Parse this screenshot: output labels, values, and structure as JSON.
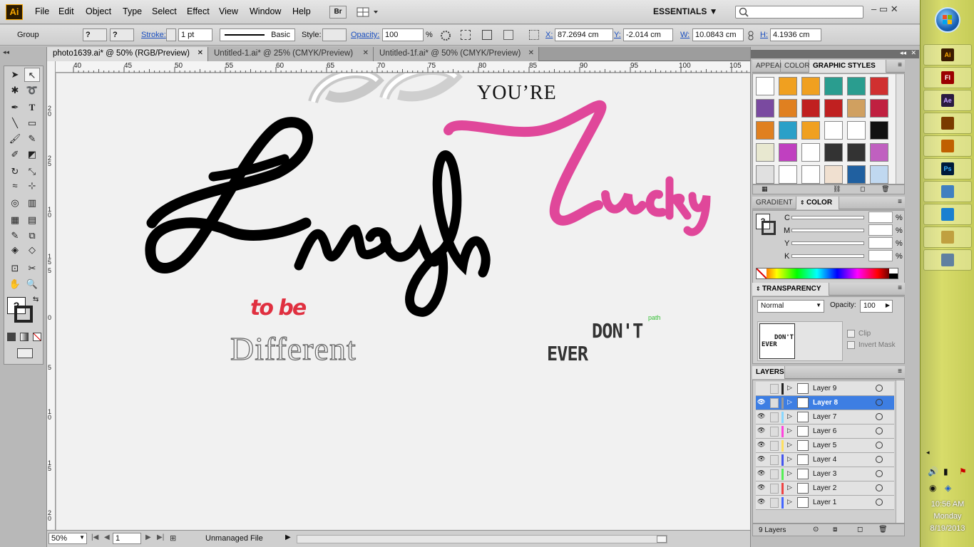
{
  "app": {
    "logo": "Ai"
  },
  "menu": [
    "File",
    "Edit",
    "Object",
    "Type",
    "Select",
    "Effect",
    "View",
    "Window",
    "Help"
  ],
  "menubar": {
    "bridge_label": "Br",
    "workspace": "ESSENTIALS ▼",
    "search_placeholder": "",
    "window_buttons": "–  ▭  ✕"
  },
  "control": {
    "selection": "Group",
    "fill_value": "?",
    "stroke_value": "?",
    "stroke_label": "Stroke:",
    "stroke_weight": "1 pt",
    "brush": "Basic",
    "style_label": "Style:",
    "opacity_label": "Opacity:",
    "opacity_value": "100",
    "opacity_unit": "%",
    "x_label": "X:",
    "x_value": "87.2694 cm",
    "y_label": "Y:",
    "y_value": "-2.014 cm",
    "w_label": "W:",
    "w_value": "10.0843 cm",
    "h_label": "H:",
    "h_value": "4.1936 cm"
  },
  "tabs": [
    {
      "label": "photo1639.ai* @ 50% (RGB/Preview)",
      "close": "✕"
    },
    {
      "label": "Untitled-1.ai* @ 25% (CMYK/Preview)",
      "close": "✕"
    },
    {
      "label": "Untitled-1f.ai* @ 50% (CMYK/Preview)",
      "close": "✕"
    }
  ],
  "ruler": {
    "h_labels": [
      "40",
      "45",
      "50",
      "55",
      "60",
      "65",
      "70",
      "75",
      "80",
      "85",
      "90",
      "95",
      "100",
      "105"
    ],
    "v_labels": [
      "2 0",
      "2 5",
      "1 0",
      "1 5",
      "5",
      "0",
      "5",
      "1 0",
      "1 5",
      "2 0"
    ]
  },
  "artwork": {
    "youre": "YOU’RE",
    "enough": "Enough",
    "lucky": "Lucky",
    "to_be": "to be",
    "different": "Different",
    "dont": "DON'T",
    "ever": "EVER",
    "path_label": "path",
    "pink_color": "#e0479a",
    "red_color": "#e03040"
  },
  "status": {
    "zoom": "50%",
    "page": "1",
    "file_status": "Unmanaged File"
  },
  "panels": {
    "top_tabs": [
      "APPEAI",
      "COLOR",
      "GRAPHIC STYLES"
    ],
    "gradient_tab": "GRADIENT",
    "color_tab": "COLOR",
    "cmyk": [
      {
        "label": "C",
        "unit": "%"
      },
      {
        "label": "M",
        "unit": "%"
      },
      {
        "label": "Y",
        "unit": "%"
      },
      {
        "label": "K",
        "unit": "%"
      }
    ],
    "transparency": {
      "title": "TRANSPARENCY",
      "mode": "Normal",
      "opacity_label": "Opacity:",
      "opacity_value": "100",
      "thumb_line1": "DON'T",
      "thumb_line2": "EVER",
      "clip": "Clip",
      "invert": "Invert Mask"
    },
    "layers": {
      "title": "LAYERS",
      "items": [
        {
          "name": "Layer 9",
          "color": "#222222"
        },
        {
          "name": "Layer 8",
          "color": "#999999"
        },
        {
          "name": "Layer 7",
          "color": "#88d8ff"
        },
        {
          "name": "Layer 6",
          "color": "#ff44dd"
        },
        {
          "name": "Layer 5",
          "color": "#ffe060"
        },
        {
          "name": "Layer 4",
          "color": "#4455ee"
        },
        {
          "name": "Layer 3",
          "color": "#55ee55"
        },
        {
          "name": "Layer 2",
          "color": "#ee4444"
        },
        {
          "name": "Layer 1",
          "color": "#4466ff"
        }
      ],
      "count": "9 Layers"
    }
  },
  "taskbar": {
    "time": "10:56 AM",
    "day": "Monday",
    "date": "8/19/2013",
    "apps": [
      "Ai",
      "Fl",
      "Ae",
      "",
      "",
      "Ps",
      "",
      "",
      "",
      ""
    ]
  }
}
